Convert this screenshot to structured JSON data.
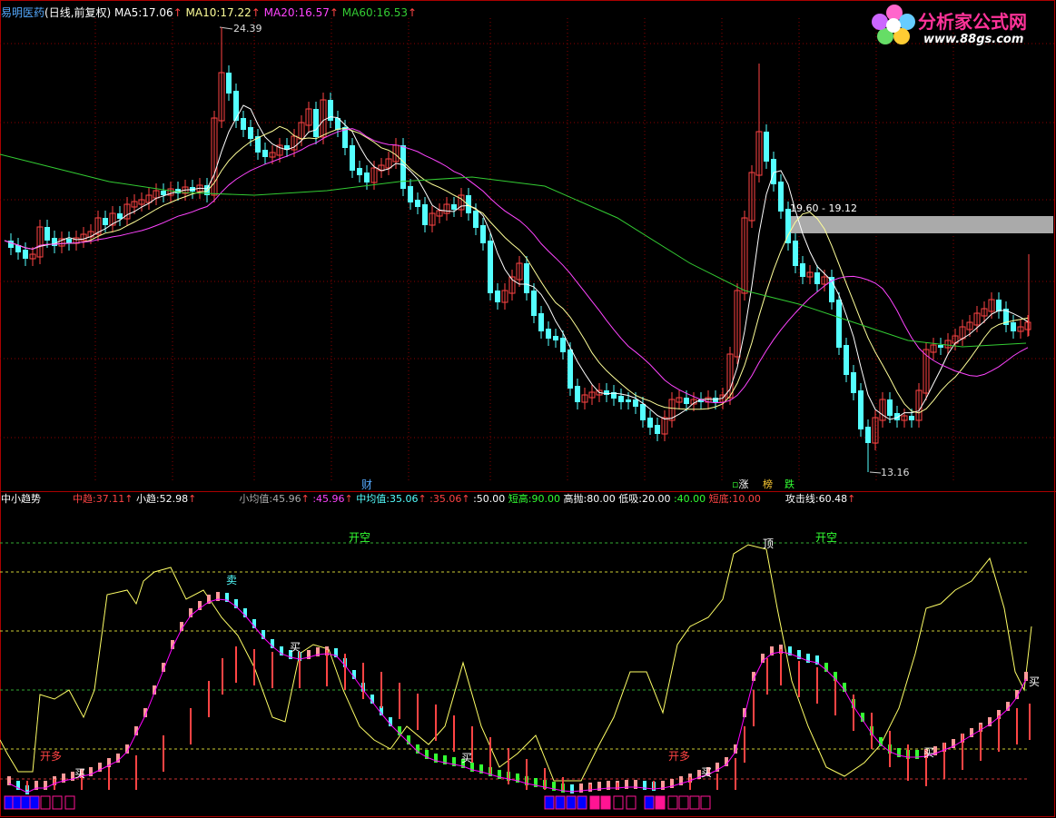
{
  "colors": {
    "bg": "#000000",
    "frame": "#aa0000",
    "grid": "#8b0000",
    "up": "#ff4444",
    "down": "#54ffff",
    "ma5": "#ffffff",
    "ma10": "#ffff99",
    "ma20": "#ff44ff",
    "ma60": "#33cc33",
    "yellow": "#ffff66",
    "green": "#33ff33",
    "pink": "#ff9999",
    "magenta": "#ff00ff",
    "cyan": "#00ffff"
  },
  "header": {
    "stock_name": "易明医药",
    "period": "(日线,前复权)",
    "ma5_label": "MA5:",
    "ma5_value": "17.06",
    "ma10_label": "MA10:",
    "ma10_value": "17.22",
    "ma20_label": "MA20:",
    "ma20_value": "16.57",
    "ma60_label": "MA60:",
    "ma60_value": "16.53",
    "arrow": "↑"
  },
  "logo": {
    "brand": "分析家公式网",
    "url": "www.88gs.com"
  },
  "price_chart": {
    "high_label": "24.39",
    "low_label": "13.16",
    "range_label": "19.60 - 19.12",
    "event_cai": "财",
    "event_zhang": "涨",
    "event_bang": "榜",
    "event_die": "跌"
  },
  "indicator": {
    "name": "中小趋势",
    "zhong_label": "中趋:",
    "zhong_value": "37.11",
    "xiao_label": "小趋:",
    "xiao_value": "52.98",
    "xjz_label": "小均值:",
    "xjz_value": "45.96",
    "xjz2_value": ":45.96",
    "zjz_label": "中均值:",
    "zjz_value": "35.06",
    "zjz2_value": ":35.06",
    "fifty": ":50.00",
    "dg_label": "短高:",
    "dg_value": "90.00",
    "gp_label": "高抛:",
    "gp_value": "80.00",
    "dx_label": "低吸:",
    "dx_value": "20.00",
    "forty": ":40.00",
    "dd_label": "短底:",
    "dd_value": "10.00",
    "gjx_label": "攻击线:",
    "gjx_value": "60.48",
    "arrow": "↑",
    "sig_kaikong1": "开空",
    "sig_kaikong2": "开空",
    "sig_ding": "顶",
    "sig_mai_top": "卖",
    "sig_kaiduo1": "开多",
    "sig_kaiduo2": "开多",
    "sig_mai_1": "买",
    "sig_mai_2": "买",
    "sig_mai_3": "买",
    "sig_mai_4": "买",
    "sig_mai_5": "买",
    "sig_mai_end": "买"
  }
}
